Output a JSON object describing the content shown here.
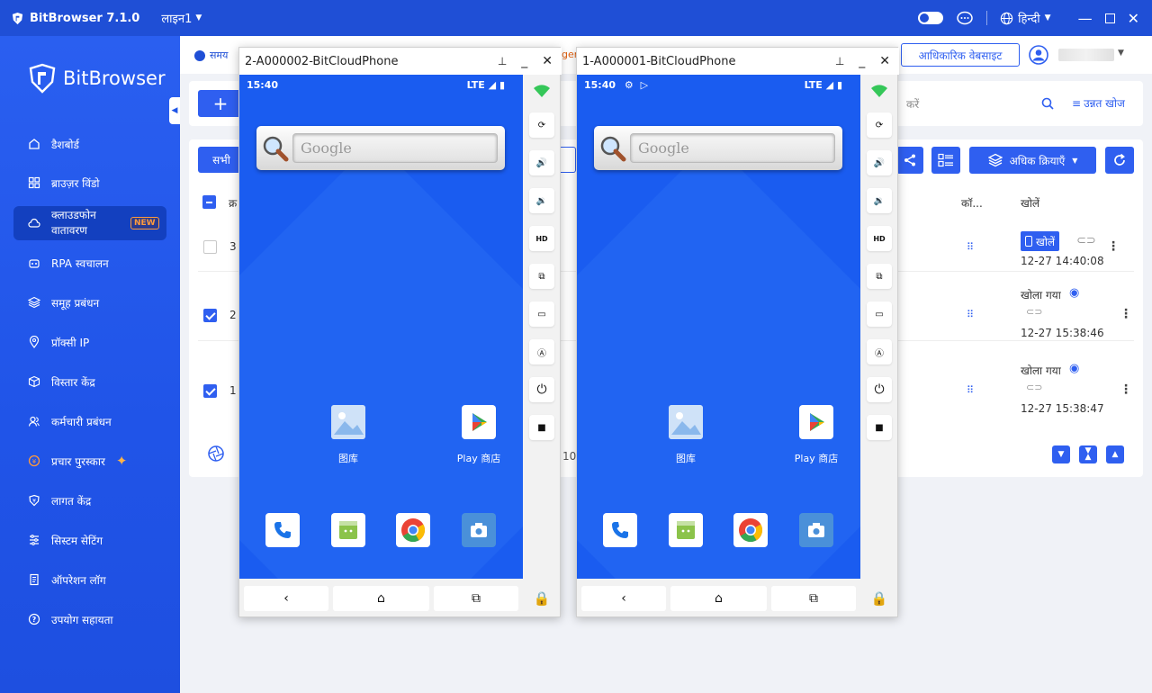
{
  "titlebar": {
    "app_name": "BitBrowser 7.1.0",
    "line_selector": "लाइन1",
    "language": "हिन्दी"
  },
  "sidebar": {
    "brand": "BitBrowser",
    "items": [
      {
        "label": "डैशबोर्ड",
        "icon": "home-icon"
      },
      {
        "label": "ब्राउज़र विंडो",
        "icon": "grid-icon"
      },
      {
        "label": "क्लाउडफोन वातावरण",
        "icon": "cloud-icon",
        "badge": "NEW",
        "active": true
      },
      {
        "label": "RPA स्वचालन",
        "icon": "robot-icon"
      },
      {
        "label": "समूह प्रबंधन",
        "icon": "layers-icon"
      },
      {
        "label": "प्रॉक्सी IP",
        "icon": "location-icon"
      },
      {
        "label": "विस्तार केंद्र",
        "icon": "cube-icon"
      },
      {
        "label": "कर्मचारी प्रबंधन",
        "icon": "users-icon"
      },
      {
        "label": "प्रचार पुरस्कार",
        "icon": "reward-icon"
      },
      {
        "label": "लागत केंद्र",
        "icon": "shield-icon"
      },
      {
        "label": "सिस्टम सेटिंग",
        "icon": "settings-icon"
      },
      {
        "label": "ऑपरेशन लॉग",
        "icon": "log-icon"
      },
      {
        "label": "उपयोग सहायता",
        "icon": "help-icon"
      }
    ]
  },
  "main": {
    "time_label": "समय",
    "top_fragment": "ger",
    "official_site": "आधिकारिक वेबसाइट",
    "search_placeholder_fragment": "करें",
    "advanced_search": "उन्नत खोज",
    "filter_all": "सभी",
    "more_actions": "अधिक क्रियाएँ",
    "header_fragment": "क्र",
    "col_config": "कॉ...",
    "col_open": "खोलें",
    "rows": [
      {
        "num": "3",
        "checked": false,
        "status": "खोलें",
        "time": "12-27 14:40:08"
      },
      {
        "num": "2",
        "checked": true,
        "status": "खोला गया",
        "time": "12-27 15:38:46"
      },
      {
        "num": "1",
        "checked": true,
        "status": "खोला गया",
        "time": "12-27 15:38:47"
      }
    ],
    "pager_fragment": "10"
  },
  "phones": [
    {
      "title": "2-A000002-BitCloudPhone",
      "time": "15:40",
      "network": "LTE",
      "search_hint": "Google",
      "apps": [
        "图库",
        "Play 商店"
      ]
    },
    {
      "title": "1-A000001-BitCloudPhone",
      "time": "15:40",
      "network": "LTE",
      "search_hint": "Google",
      "apps": [
        "图库",
        "Play 商店"
      ]
    }
  ],
  "colors": {
    "primary": "#2f5ff0",
    "sidebar": "#2054e8",
    "phone_screen": "#1a5cf0"
  }
}
